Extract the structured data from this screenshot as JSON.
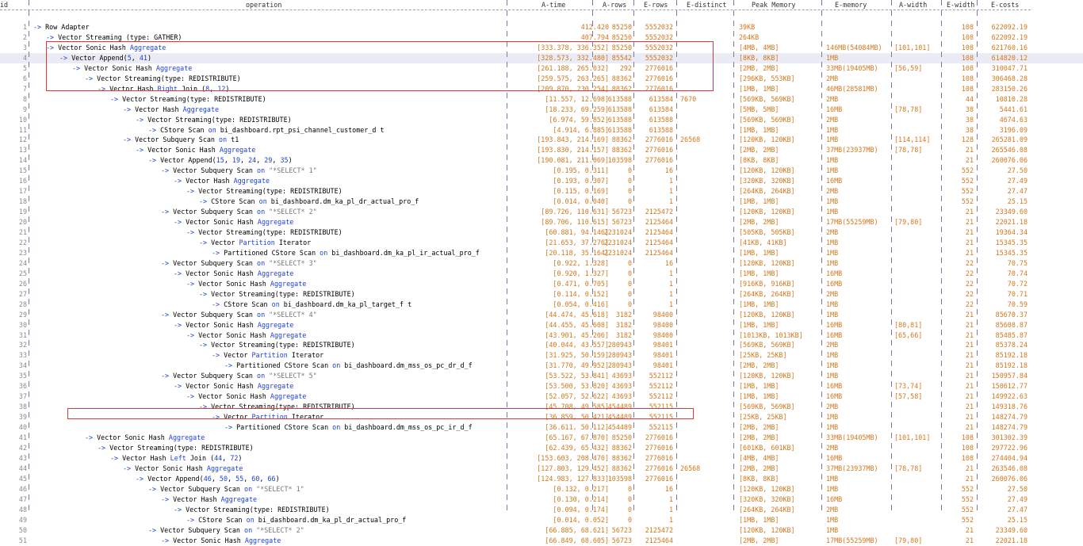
{
  "headers": {
    "id": "id",
    "operation": "operation",
    "a_time": "A-time",
    "a_rows": "A-rows",
    "e_rows": "E-rows",
    "e_distinct": "E-distinct",
    "peak_memory": "Peak Memory",
    "e_memory": "E-memory",
    "a_width": "A-width",
    "e_width": "E-width",
    "e_costs": "E-costs"
  },
  "colors": {
    "number": "#d2781c",
    "keyword": "#1a3fd6",
    "highlight_box": "#d83a3a",
    "selected_row": "#ebebf6"
  },
  "selected_row": 4,
  "highlight_ranges": [
    [
      3,
      7
    ],
    [
      41,
      41
    ]
  ],
  "rows": [
    {
      "id": "1",
      "op": "-> Row Adapter",
      "at": "412.420",
      "ar": "85250",
      "er": "5552032",
      "ed": "",
      "pm": "39KB",
      "em": "",
      "aw": "",
      "ew": "108",
      "ec": "622092.19"
    },
    {
      "id": "2",
      "op": "-> Vector Streaming (type: GATHER)",
      "at": "407.794",
      "ar": "85250",
      "er": "5552032",
      "ed": "",
      "pm": "264KB",
      "em": "",
      "aw": "",
      "ew": "108",
      "ec": "622092.19"
    },
    {
      "id": "3",
      "op": "-> Vector Sonic Hash Aggregate",
      "at": "[333.378, 336.352]",
      "ar": "85250",
      "er": "5552032",
      "ed": "",
      "pm": "[4MB, 4MB]",
      "em": "146MB(54084MB)",
      "aw": "[101,101]",
      "ew": "108",
      "ec": "621760.16"
    },
    {
      "id": "4",
      "op": "-> Vector Append(5, 41)",
      "at": "[328.573, 332.480]",
      "ar": "85542",
      "er": "5552032",
      "ed": "",
      "pm": "[8KB, 8KB]",
      "em": "1MB",
      "aw": "",
      "ew": "108",
      "ec": "614820.12"
    },
    {
      "id": "5",
      "op": "-> Vector Sonic Hash Aggregate",
      "at": "[261.188, 265.032]",
      "ar": "292",
      "er": "2776016",
      "ed": "",
      "pm": "[2MB, 2MB]",
      "em": "33MB(19405MB)",
      "aw": "[56,59]",
      "ew": "108",
      "ec": "310047.71"
    },
    {
      "id": "6",
      "op": "-> Vector Streaming(type: REDISTRIBUTE)",
      "at": "[259.575, 263.265]",
      "ar": "88362",
      "er": "2776016",
      "ed": "",
      "pm": "[296KB, 553KB]",
      "em": "2MB",
      "aw": "",
      "ew": "108",
      "ec": "306468.28"
    },
    {
      "id": "7",
      "op": "-> Vector Hash Right Join (8, 12)",
      "at": "[209.870, 230.254]",
      "ar": "88362",
      "er": "2776016",
      "ed": "",
      "pm": "[1MB, 1MB]",
      "em": "46MB(28581MB)",
      "aw": "",
      "ew": "108",
      "ec": "283150.26"
    },
    {
      "id": "8",
      "op": "-> Vector Streaming(type: REDISTRIBUTE)",
      "at": "[11.557, 12.698]",
      "ar": "613588",
      "er": "613584",
      "ed": "7670",
      "pm": "[569KB, 569KB]",
      "em": "2MB",
      "aw": "",
      "ew": "44",
      "ec": "10810.28"
    },
    {
      "id": "9",
      "op": "-> Vector Hash Aggregate",
      "at": "[18.233, 69.259]",
      "ar": "613588",
      "er": "613584",
      "ed": "",
      "pm": "[5MB, 5MB]",
      "em": "16MB",
      "aw": "[78,78]",
      "ew": "38",
      "ec": "5441.61"
    },
    {
      "id": "10",
      "op": "-> Vector Streaming(type: REDISTRIBUTE)",
      "at": "[6.974, 59.852]",
      "ar": "613588",
      "er": "613588",
      "ed": "",
      "pm": "[569KB, 569KB]",
      "em": "2MB",
      "aw": "",
      "ew": "38",
      "ec": "4674.63"
    },
    {
      "id": "11",
      "op": "-> CStore Scan on bi_dashboard.rpt_psi_channel_customer_d t",
      "at": "[4.914, 6.885]",
      "ar": "613588",
      "er": "613588",
      "ed": "",
      "pm": "[1MB, 1MB]",
      "em": "1MB",
      "aw": "",
      "ew": "38",
      "ec": "3196.09"
    },
    {
      "id": "12",
      "op": "-> Vector Subquery Scan on t1",
      "at": "[193.843, 214.169]",
      "ar": "88362",
      "er": "2776016",
      "ed": "26568",
      "pm": "[120KB, 120KB]",
      "em": "1MB",
      "aw": "[114,114]",
      "ew": "128",
      "ec": "265281.09"
    },
    {
      "id": "13",
      "op": "-> Vector Sonic Hash Aggregate",
      "at": "[193.830, 214.157]",
      "ar": "88362",
      "er": "2776016",
      "ed": "",
      "pm": "[2MB, 2MB]",
      "em": "37MB(23937MB)",
      "aw": "[78,78]",
      "ew": "21",
      "ec": "265546.08"
    },
    {
      "id": "14",
      "op": "-> Vector Append(15, 19, 24, 29, 35)",
      "at": "[190.081, 211.069]",
      "ar": "103598",
      "er": "2776016",
      "ed": "",
      "pm": "[8KB, 8KB]",
      "em": "1MB",
      "aw": "",
      "ew": "21",
      "ec": "260076.06"
    },
    {
      "id": "15",
      "op": "-> Vector Subquery Scan on \"*SELECT* 1\"",
      "at": "[0.195, 0.311]",
      "ar": "0",
      "er": "16",
      "ed": "",
      "pm": "[120KB, 120KB]",
      "em": "1MB",
      "aw": "",
      "ew": "552",
      "ec": "27.50"
    },
    {
      "id": "16",
      "op": "-> Vector Hash Aggregate",
      "at": "[0.193, 0.307]",
      "ar": "0",
      "er": "1",
      "ed": "",
      "pm": "[320KB, 320KB]",
      "em": "16MB",
      "aw": "",
      "ew": "552",
      "ec": "27.49"
    },
    {
      "id": "17",
      "op": "-> Vector Streaming(type: REDISTRIBUTE)",
      "at": "[0.115, 0.169]",
      "ar": "0",
      "er": "1",
      "ed": "",
      "pm": "[264KB, 264KB]",
      "em": "2MB",
      "aw": "",
      "ew": "552",
      "ec": "27.47"
    },
    {
      "id": "18",
      "op": "-> CStore Scan on bi_dashboard.dm_ka_pl_dr_actual_pro_f",
      "at": "[0.014, 0.040]",
      "ar": "0",
      "er": "1",
      "ed": "",
      "pm": "[1MB, 1MB]",
      "em": "1MB",
      "aw": "",
      "ew": "552",
      "ec": "25.15"
    },
    {
      "id": "19",
      "op": "-> Vector Subquery Scan on \"*SELECT* 2\"",
      "at": "[89.726, 110.631]",
      "ar": "56723",
      "er": "2125472",
      "ed": "",
      "pm": "[120KB, 120KB]",
      "em": "1MB",
      "aw": "",
      "ew": "21",
      "ec": "23349.60"
    },
    {
      "id": "20",
      "op": "-> Vector Sonic Hash Aggregate",
      "at": "[89.706, 110.615]",
      "ar": "56723",
      "er": "2125464",
      "ed": "",
      "pm": "[2MB, 2MB]",
      "em": "17MB(55259MB)",
      "aw": "[79,80]",
      "ew": "21",
      "ec": "22021.18"
    },
    {
      "id": "21",
      "op": "-> Vector Streaming(type: REDISTRIBUTE)",
      "at": "[60.881, 94.146]",
      "ar": "2231024",
      "er": "2125464",
      "ed": "",
      "pm": "[505KB, 505KB]",
      "em": "2MB",
      "aw": "",
      "ew": "21",
      "ec": "19364.34"
    },
    {
      "id": "22",
      "op": "-> Vector Partition Iterator",
      "at": "[21.653, 37.276]",
      "ar": "2231024",
      "er": "2125464",
      "ed": "",
      "pm": "[41KB, 41KB]",
      "em": "1MB",
      "aw": "",
      "ew": "21",
      "ec": "15345.35"
    },
    {
      "id": "23",
      "op": "-> Partitioned CStore Scan on bi_dashboard.dm_ka_pl_ir_actual_pro_f",
      "at": "[20.118, 35.164]",
      "ar": "2231024",
      "er": "2125464",
      "ed": "",
      "pm": "[1MB, 1MB]",
      "em": "1MB",
      "aw": "",
      "ew": "21",
      "ec": "15345.35"
    },
    {
      "id": "24",
      "op": "-> Vector Subquery Scan on \"*SELECT* 3\"",
      "at": "[0.922, 1.328]",
      "ar": "0",
      "er": "16",
      "ed": "",
      "pm": "[120KB, 120KB]",
      "em": "1MB",
      "aw": "",
      "ew": "22",
      "ec": "70.75"
    },
    {
      "id": "25",
      "op": "-> Vector Sonic Hash Aggregate",
      "at": "[0.920, 1.327]",
      "ar": "0",
      "er": "1",
      "ed": "",
      "pm": "[1MB, 1MB]",
      "em": "16MB",
      "aw": "",
      "ew": "22",
      "ec": "70.74"
    },
    {
      "id": "26",
      "op": "-> Vector Sonic Hash Aggregate",
      "at": "[0.471, 0.705]",
      "ar": "0",
      "er": "1",
      "ed": "",
      "pm": "[916KB, 916KB]",
      "em": "16MB",
      "aw": "",
      "ew": "22",
      "ec": "70.72"
    },
    {
      "id": "27",
      "op": "-> Vector Streaming(type: REDISTRIBUTE)",
      "at": "[0.114, 0.152]",
      "ar": "0",
      "er": "1",
      "ed": "",
      "pm": "[264KB, 264KB]",
      "em": "2MB",
      "aw": "",
      "ew": "22",
      "ec": "70.71"
    },
    {
      "id": "28",
      "op": "-> CStore Scan on bi_dashboard.dm_ka_pl_target_f t",
      "at": "[0.054, 0.416]",
      "ar": "0",
      "er": "1",
      "ed": "",
      "pm": "[1MB, 1MB]",
      "em": "1MB",
      "aw": "",
      "ew": "22",
      "ec": "70.59"
    },
    {
      "id": "29",
      "op": "-> Vector Subquery Scan on \"*SELECT* 4\"",
      "at": "[44.474, 45.618]",
      "ar": "3182",
      "er": "98400",
      "ed": "",
      "pm": "[120KB, 120KB]",
      "em": "1MB",
      "aw": "",
      "ew": "21",
      "ec": "85670.37"
    },
    {
      "id": "30",
      "op": "-> Vector Sonic Hash Aggregate",
      "at": "[44.455, 45.608]",
      "ar": "3182",
      "er": "98400",
      "ed": "",
      "pm": "[1MB, 1MB]",
      "em": "16MB",
      "aw": "[80,81]",
      "ew": "21",
      "ec": "85608.87"
    },
    {
      "id": "31",
      "op": "-> Vector Sonic Hash Aggregate",
      "at": "[43.901, 45.206]",
      "ar": "3182",
      "er": "98400",
      "ed": "",
      "pm": "[1013KB, 1013KB]",
      "em": "16MB",
      "aw": "[65,66]",
      "ew": "21",
      "ec": "85485.87"
    },
    {
      "id": "32",
      "op": "-> Vector Streaming(type: REDISTRIBUTE)",
      "at": "[40.044, 43.557]",
      "ar": "280943",
      "er": "98401",
      "ed": "",
      "pm": "[569KB, 569KB]",
      "em": "2MB",
      "aw": "",
      "ew": "21",
      "ec": "85378.24"
    },
    {
      "id": "33",
      "op": "-> Vector Partition Iterator",
      "at": "[31.925, 50.159]",
      "ar": "280943",
      "er": "98401",
      "ed": "",
      "pm": "[25KB, 25KB]",
      "em": "1MB",
      "aw": "",
      "ew": "21",
      "ec": "85192.18"
    },
    {
      "id": "34",
      "op": "-> Partitioned CStore Scan on bi_dashboard.dm_mss_os_pc_dr_d_f",
      "at": "[31.770, 49.952]",
      "ar": "280943",
      "er": "98401",
      "ed": "",
      "pm": "[2MB, 2MB]",
      "em": "1MB",
      "aw": "",
      "ew": "21",
      "ec": "85192.18"
    },
    {
      "id": "35",
      "op": "-> Vector Subquery Scan on \"*SELECT* 5\"",
      "at": "[53.522, 53.841]",
      "ar": "43693",
      "er": "552112",
      "ed": "",
      "pm": "[120KB, 120KB]",
      "em": "1MB",
      "aw": "",
      "ew": "21",
      "ec": "150957.84"
    },
    {
      "id": "36",
      "op": "-> Vector Sonic Hash Aggregate",
      "at": "[53.500, 53.820]",
      "ar": "43693",
      "er": "552112",
      "ed": "",
      "pm": "[1MB, 1MB]",
      "em": "16MB",
      "aw": "[73,74]",
      "ew": "21",
      "ec": "150612.77"
    },
    {
      "id": "37",
      "op": "-> Vector Sonic Hash Aggregate",
      "at": "[52.057, 52.622]",
      "ar": "43693",
      "er": "552112",
      "ed": "",
      "pm": "[1MB, 1MB]",
      "em": "16MB",
      "aw": "[57,58]",
      "ew": "21",
      "ec": "149922.63"
    },
    {
      "id": "38",
      "op": "-> Vector Streaming(type: REDISTRIBUTE)",
      "at": "[45.708, 49.585]",
      "ar": "454489",
      "er": "552115",
      "ed": "",
      "pm": "[569KB, 569KB]",
      "em": "2MB",
      "aw": "",
      "ew": "21",
      "ec": "149318.76"
    },
    {
      "id": "39",
      "op": "-> Vector Partition Iterator",
      "at": "[36.859, 50.421]",
      "ar": "454489",
      "er": "552115",
      "ed": "",
      "pm": "[25KB, 25KB]",
      "em": "1MB",
      "aw": "",
      "ew": "21",
      "ec": "148274.79"
    },
    {
      "id": "40",
      "op": "-> Partitioned CStore Scan on bi_dashboard.dm_mss_os_pc_ir_d_f",
      "at": "[36.611, 50.112]",
      "ar": "454489",
      "er": "552115",
      "ed": "",
      "pm": "[2MB, 2MB]",
      "em": "1MB",
      "aw": "",
      "ew": "21",
      "ec": "148274.79"
    },
    {
      "id": "41",
      "op": "-> Vector Sonic Hash Aggregate",
      "at": "[65.167, 67.870]",
      "ar": "85250",
      "er": "2776016",
      "ed": "",
      "pm": "[2MB, 2MB]",
      "em": "33MB(19405MB)",
      "aw": "[101,101]",
      "ew": "108",
      "ec": "301302.39"
    },
    {
      "id": "42",
      "op": "-> Vector Streaming(type: REDISTRIBUTE)",
      "at": "[62.439, 65.432]",
      "ar": "88362",
      "er": "2776016",
      "ed": "",
      "pm": "[601KB, 601KB]",
      "em": "2MB",
      "aw": "",
      "ew": "108",
      "ec": "297722.96"
    },
    {
      "id": "43",
      "op": "-> Vector Hash Left Join (44, 72)",
      "at": "[153.603, 208.470]",
      "ar": "88362",
      "er": "2776016",
      "ed": "",
      "pm": "[4MB, 4MB]",
      "em": "16MB",
      "aw": "",
      "ew": "108",
      "ec": "274404.94"
    },
    {
      "id": "44",
      "op": "-> Vector Sonic Hash Aggregate",
      "at": "[127.803, 129.452]",
      "ar": "88362",
      "er": "2776016",
      "ed": "26568",
      "pm": "[2MB, 2MB]",
      "em": "37MB(23937MB)",
      "aw": "[78,78]",
      "ew": "21",
      "ec": "263546.08"
    },
    {
      "id": "45",
      "op": "-> Vector Append(46, 50, 55, 60, 66)",
      "at": "[124.983, 127.833]",
      "ar": "103598",
      "er": "2776016",
      "ed": "",
      "pm": "[8KB, 8KB]",
      "em": "1MB",
      "aw": "",
      "ew": "21",
      "ec": "260076.06"
    },
    {
      "id": "46",
      "op": "-> Vector Subquery Scan on \"*SELECT* 1\"",
      "at": "[0.132, 0.217]",
      "ar": "0",
      "er": "16",
      "ed": "",
      "pm": "[120KB, 120KB]",
      "em": "1MB",
      "aw": "",
      "ew": "552",
      "ec": "27.50"
    },
    {
      "id": "47",
      "op": "-> Vector Hash Aggregate",
      "at": "[0.130, 0.214]",
      "ar": "0",
      "er": "1",
      "ed": "",
      "pm": "[320KB, 320KB]",
      "em": "16MB",
      "aw": "",
      "ew": "552",
      "ec": "27.49"
    },
    {
      "id": "48",
      "op": "-> Vector Streaming(type: REDISTRIBUTE)",
      "at": "[0.094, 0.174]",
      "ar": "0",
      "er": "1",
      "ed": "",
      "pm": "[264KB, 264KB]",
      "em": "2MB",
      "aw": "",
      "ew": "552",
      "ec": "27.47"
    },
    {
      "id": "49",
      "op": "-> CStore Scan on bi_dashboard.dm_ka_pl_dr_actual_pro_f",
      "at": "[0.014, 0.052]",
      "ar": "0",
      "er": "1",
      "ed": "",
      "pm": "[1MB, 1MB]",
      "em": "1MB",
      "aw": "",
      "ew": "552",
      "ec": "25.15"
    },
    {
      "id": "50",
      "op": "-> Vector Subquery Scan on \"*SELECT* 2\"",
      "at": "[66.885, 68.621]",
      "ar": "56723",
      "er": "2125472",
      "ed": "",
      "pm": "[120KB, 120KB]",
      "em": "1MB",
      "aw": "",
      "ew": "21",
      "ec": "23349.60"
    },
    {
      "id": "51",
      "op": "-> Vector Sonic Hash Aggregate",
      "at": "[66.849, 68.605]",
      "ar": "56723",
      "er": "2125464",
      "ed": "",
      "pm": "[2MB, 2MB]",
      "em": "17MB(55259MB)",
      "aw": "[79,80]",
      "ew": "21",
      "ec": "22021.18"
    }
  ]
}
